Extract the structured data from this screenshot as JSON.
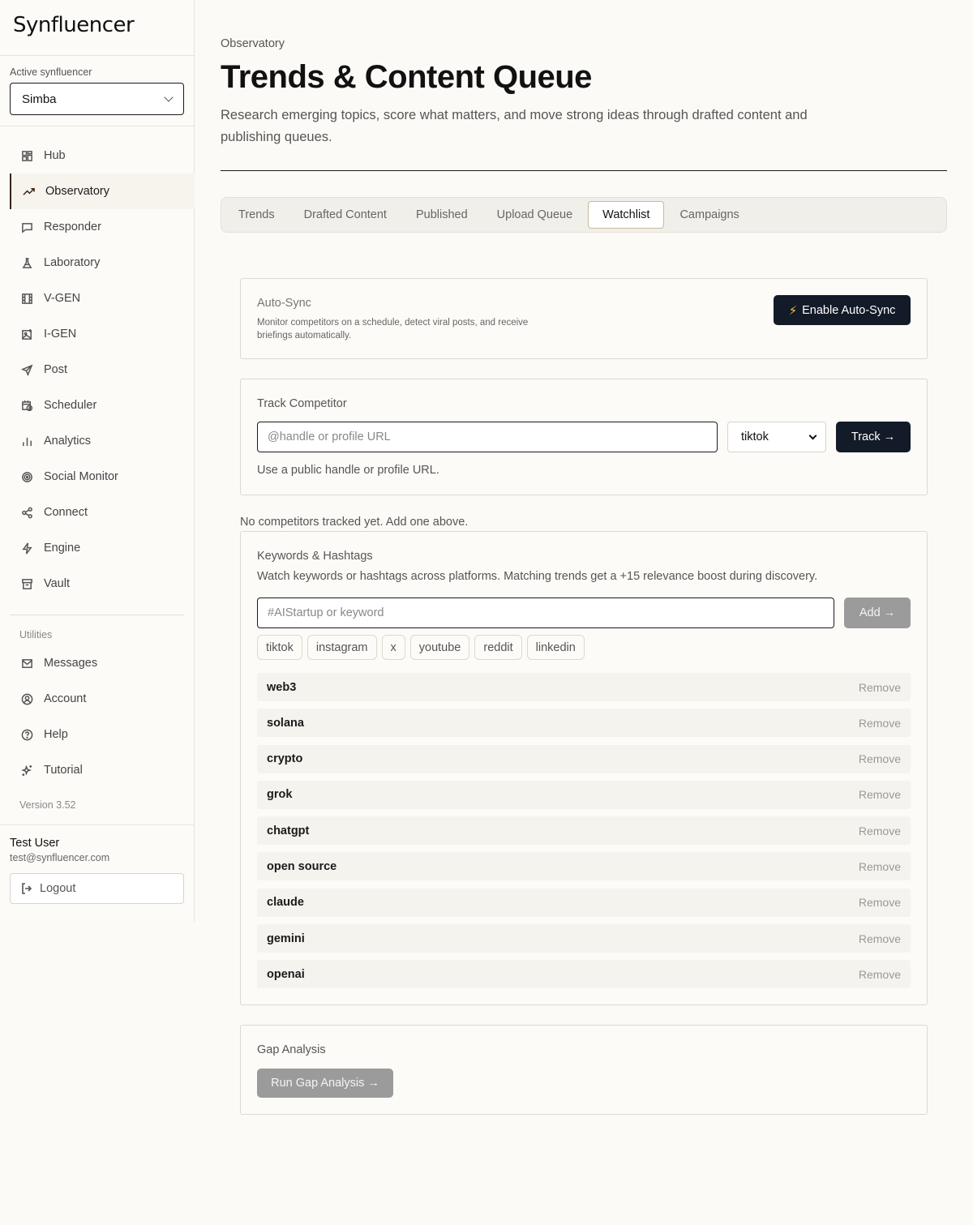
{
  "app": {
    "logo": "Synfluencer"
  },
  "sidebar": {
    "active_label": "Active synfluencer",
    "active_value": "Simba",
    "items": [
      {
        "label": "Hub",
        "icon": "grid-icon"
      },
      {
        "label": "Observatory",
        "icon": "trend-icon"
      },
      {
        "label": "Responder",
        "icon": "chat-icon"
      },
      {
        "label": "Laboratory",
        "icon": "flask-icon"
      },
      {
        "label": "V-GEN",
        "icon": "film-icon"
      },
      {
        "label": "I-GEN",
        "icon": "image-icon"
      },
      {
        "label": "Post",
        "icon": "send-icon"
      },
      {
        "label": "Scheduler",
        "icon": "calendar-clock-icon"
      },
      {
        "label": "Analytics",
        "icon": "bar-chart-icon"
      },
      {
        "label": "Social Monitor",
        "icon": "radar-icon"
      },
      {
        "label": "Connect",
        "icon": "share-icon"
      },
      {
        "label": "Engine",
        "icon": "bolt-icon"
      },
      {
        "label": "Vault",
        "icon": "archive-icon"
      }
    ],
    "utilities_label": "Utilities",
    "utilities": [
      {
        "label": "Messages",
        "icon": "mail-icon"
      },
      {
        "label": "Account",
        "icon": "user-circle-icon"
      },
      {
        "label": "Help",
        "icon": "help-icon"
      },
      {
        "label": "Tutorial",
        "icon": "sparkles-icon"
      }
    ],
    "version": "Version 3.52",
    "user": {
      "name": "Test User",
      "email": "test@synfluencer.com"
    },
    "logout_label": "Logout"
  },
  "header": {
    "breadcrumb": "Observatory",
    "title": "Trends & Content Queue",
    "description": "Research emerging topics, score what matters, and move strong ideas through drafted content and publishing queues."
  },
  "tabs": [
    "Trends",
    "Drafted Content",
    "Published",
    "Upload Queue",
    "Watchlist",
    "Campaigns"
  ],
  "active_tab": "Watchlist",
  "autosync": {
    "title": "Auto-Sync",
    "description": "Monitor competitors on a schedule, detect viral posts, and receive briefings automatically.",
    "button": "Enable Auto-Sync"
  },
  "track": {
    "title": "Track Competitor",
    "placeholder": "@handle or profile URL",
    "platform": "tiktok",
    "button": "Track →",
    "help": "Use a public handle or profile URL."
  },
  "no_competitors": "No competitors tracked yet. Add one above.",
  "keywords": {
    "title": "Keywords & Hashtags",
    "description": "Watch keywords or hashtags across platforms. Matching trends get a +15 relevance boost during discovery.",
    "placeholder": "#AIStartup or keyword",
    "add_button": "Add →",
    "platforms": [
      "tiktok",
      "instagram",
      "x",
      "youtube",
      "reddit",
      "linkedin"
    ],
    "remove_label": "Remove",
    "items": [
      "web3",
      "solana",
      "crypto",
      "grok",
      "chatgpt",
      "open source",
      "claude",
      "gemini",
      "openai"
    ]
  },
  "gap": {
    "title": "Gap Analysis",
    "button": "Run Gap Analysis →"
  }
}
